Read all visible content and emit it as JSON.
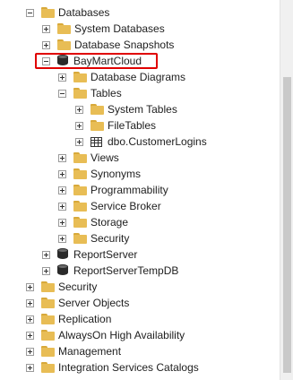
{
  "tree": {
    "items": [
      {
        "id": "databases",
        "label": "Databases",
        "indent": 1,
        "expander": "minus",
        "icon": "folder"
      },
      {
        "id": "system-databases",
        "label": "System Databases",
        "indent": 2,
        "expander": "plus",
        "icon": "folder"
      },
      {
        "id": "database-snapshots",
        "label": "Database Snapshots",
        "indent": 2,
        "expander": "plus",
        "icon": "folder"
      },
      {
        "id": "baymartcloud",
        "label": "BayMartCloud",
        "indent": 2,
        "expander": "minus",
        "icon": "database"
      },
      {
        "id": "database-diagrams",
        "label": "Database Diagrams",
        "indent": 3,
        "expander": "plus",
        "icon": "folder"
      },
      {
        "id": "tables",
        "label": "Tables",
        "indent": 3,
        "expander": "minus",
        "icon": "folder"
      },
      {
        "id": "system-tables",
        "label": "System Tables",
        "indent": 4,
        "expander": "plus",
        "icon": "folder"
      },
      {
        "id": "filetables",
        "label": "FileTables",
        "indent": 4,
        "expander": "plus",
        "icon": "folder"
      },
      {
        "id": "dbo-customerlogins",
        "label": "dbo.CustomerLogins",
        "indent": 4,
        "expander": "plus",
        "icon": "table"
      },
      {
        "id": "views",
        "label": "Views",
        "indent": 3,
        "expander": "plus",
        "icon": "folder"
      },
      {
        "id": "synonyms",
        "label": "Synonyms",
        "indent": 3,
        "expander": "plus",
        "icon": "folder"
      },
      {
        "id": "programmability",
        "label": "Programmability",
        "indent": 3,
        "expander": "plus",
        "icon": "folder"
      },
      {
        "id": "service-broker",
        "label": "Service Broker",
        "indent": 3,
        "expander": "plus",
        "icon": "folder"
      },
      {
        "id": "storage",
        "label": "Storage",
        "indent": 3,
        "expander": "plus",
        "icon": "folder"
      },
      {
        "id": "db-security",
        "label": "Security",
        "indent": 3,
        "expander": "plus",
        "icon": "folder"
      },
      {
        "id": "reportserver",
        "label": "ReportServer",
        "indent": 2,
        "expander": "plus",
        "icon": "database"
      },
      {
        "id": "reportservertempdb",
        "label": "ReportServerTempDB",
        "indent": 2,
        "expander": "plus",
        "icon": "database"
      },
      {
        "id": "security",
        "label": "Security",
        "indent": 1,
        "expander": "plus",
        "icon": "folder"
      },
      {
        "id": "server-objects",
        "label": "Server Objects",
        "indent": 1,
        "expander": "plus",
        "icon": "folder"
      },
      {
        "id": "replication",
        "label": "Replication",
        "indent": 1,
        "expander": "plus",
        "icon": "folder"
      },
      {
        "id": "alwayson",
        "label": "AlwaysOn High Availability",
        "indent": 1,
        "expander": "plus",
        "icon": "folder"
      },
      {
        "id": "management",
        "label": "Management",
        "indent": 1,
        "expander": "plus",
        "icon": "folder"
      },
      {
        "id": "integration-services",
        "label": "Integration Services Catalogs",
        "indent": 1,
        "expander": "plus",
        "icon": "folder"
      }
    ]
  },
  "colors": {
    "highlight_border": "#e00000",
    "folder": "#e8bd55"
  }
}
